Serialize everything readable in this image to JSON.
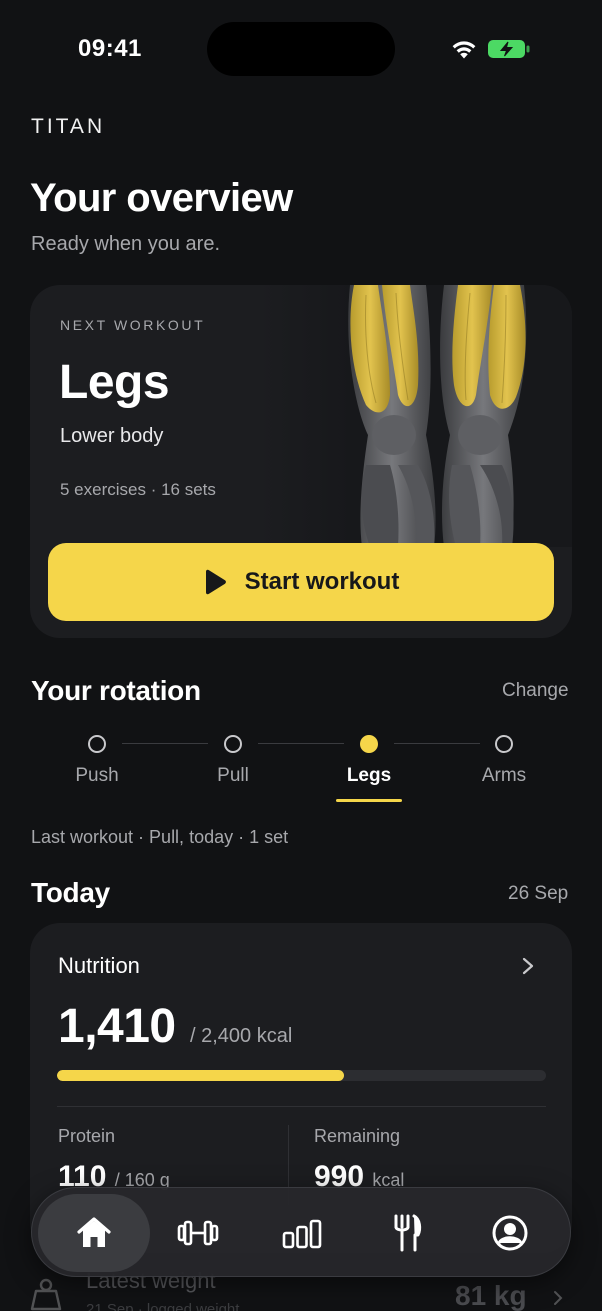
{
  "status_bar": {
    "time": "09:41"
  },
  "app": {
    "brand": "TITAN"
  },
  "header": {
    "title": "Your overview",
    "subtitle": "Ready when you are."
  },
  "next_workout": {
    "eyebrow": "NEXT WORKOUT",
    "title": "Legs",
    "subtitle": "Lower body",
    "meta": "5 exercises · 16 sets",
    "start_label": "Start workout"
  },
  "rotation": {
    "title": "Your rotation",
    "change_label": "Change",
    "items": [
      {
        "label": "Push",
        "active": false
      },
      {
        "label": "Pull",
        "active": false
      },
      {
        "label": "Legs",
        "active": true
      },
      {
        "label": "Arms",
        "active": false
      }
    ],
    "last_workout": "Last workout · Pull, today · 1 set"
  },
  "today": {
    "title": "Today",
    "date": "26 Sep",
    "nutrition": {
      "title": "Nutrition",
      "consumed": "1,410",
      "goal": "/ 2,400 kcal",
      "progress_fraction": 0.5875,
      "protein_label": "Protein",
      "protein_value": "110",
      "protein_unit": "/ 160 g",
      "remaining_label": "Remaining",
      "remaining_value": "990",
      "remaining_unit": "kcal"
    },
    "latest_weight": {
      "title": "Latest weight",
      "subtitle": "21 Sep · logged weight",
      "value": "81 kg"
    }
  },
  "tabbar": {
    "tabs": [
      {
        "icon": "home-icon",
        "active": true
      },
      {
        "icon": "dumbbell-icon",
        "active": false
      },
      {
        "icon": "stats-icon",
        "active": false
      },
      {
        "icon": "fork-knife-icon",
        "active": false
      },
      {
        "icon": "profile-icon",
        "active": false
      }
    ]
  },
  "colors": {
    "accent": "#f5d64a",
    "background": "#111214",
    "card": "#1c1d20"
  }
}
